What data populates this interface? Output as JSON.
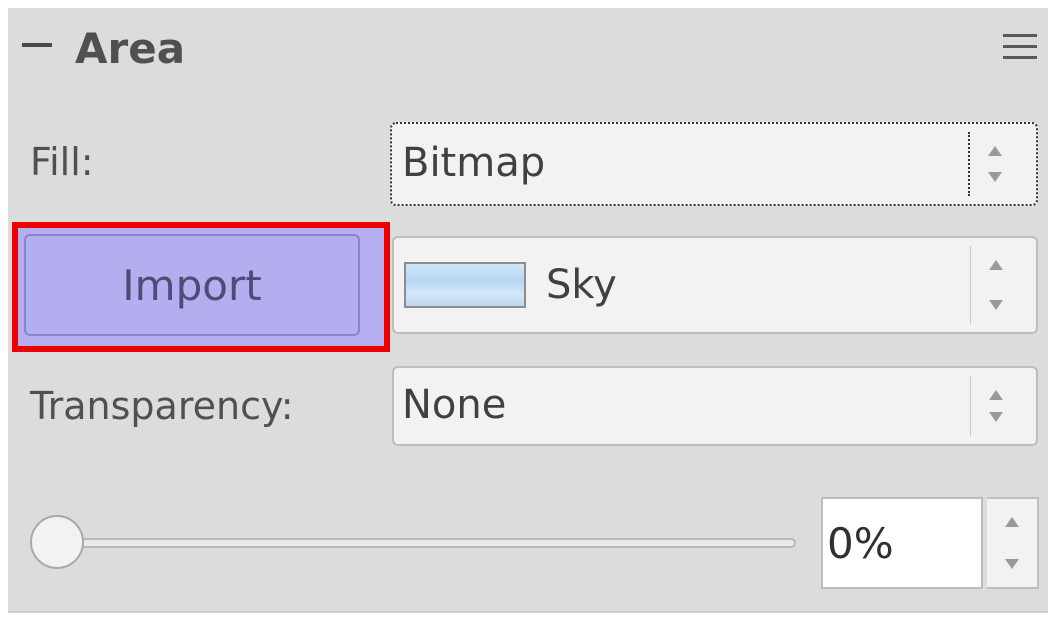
{
  "panel": {
    "title": "Area",
    "collapse_icon": "minus-icon",
    "menu_icon": "hamburger-menu-icon"
  },
  "fill": {
    "label": "Fill:",
    "value": "Bitmap"
  },
  "bitmap": {
    "import_label": "Import",
    "selected": "Sky",
    "swatch_icon": "sky-swatch"
  },
  "transparency": {
    "label": "Transparency:",
    "value": "None"
  },
  "transparency_level": {
    "value": "0%",
    "fraction": 0
  },
  "colors": {
    "panel_bg": "#dcdcdc",
    "import_highlight": "#b3aef0",
    "focus_outline": "#ee0000"
  }
}
